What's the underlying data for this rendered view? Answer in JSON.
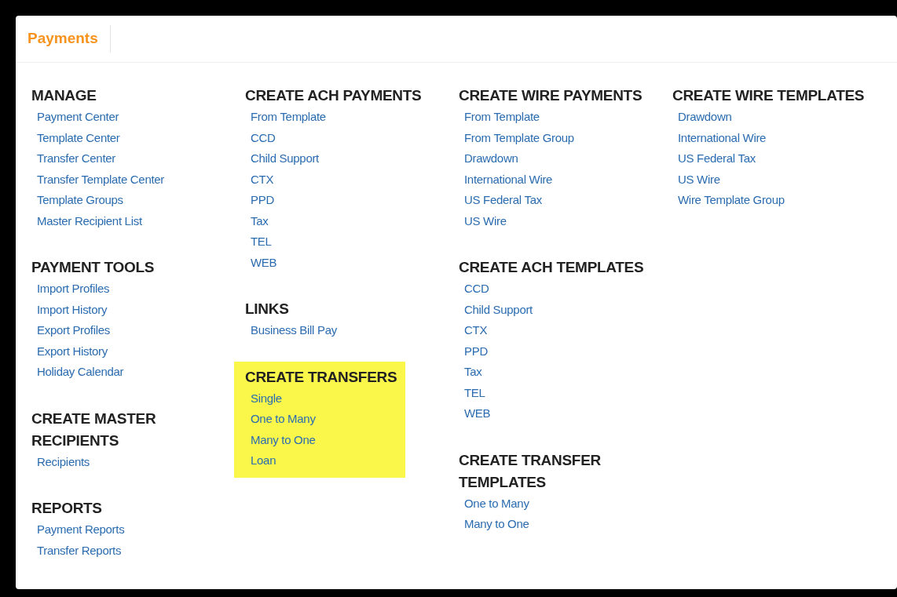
{
  "tabs": [
    {
      "label": "Payments",
      "selected": true
    }
  ],
  "columns": [
    [
      {
        "title": "MANAGE",
        "highlighted": false,
        "links": [
          "Payment Center",
          "Template Center",
          "Transfer Center",
          "Transfer Template Center",
          "Template Groups",
          "Master Recipient List"
        ]
      },
      {
        "title": "PAYMENT TOOLS",
        "highlighted": false,
        "links": [
          "Import Profiles",
          "Import History",
          "Export Profiles",
          "Export History",
          "Holiday Calendar"
        ]
      },
      {
        "title": "CREATE MASTER RECIPIENTS",
        "highlighted": false,
        "links": [
          "Recipients"
        ]
      },
      {
        "title": "REPORTS",
        "highlighted": false,
        "links": [
          "Payment Reports",
          "Transfer Reports"
        ]
      }
    ],
    [
      {
        "title": "CREATE ACH PAYMENTS",
        "highlighted": false,
        "links": [
          "From Template",
          "CCD",
          "Child Support",
          "CTX",
          "PPD",
          "Tax",
          "TEL",
          "WEB"
        ]
      },
      {
        "title": "LINKS",
        "highlighted": false,
        "links": [
          "Business Bill Pay"
        ]
      },
      {
        "title": "CREATE TRANSFERS",
        "highlighted": true,
        "links": [
          "Single",
          "One to Many",
          "Many to One",
          "Loan"
        ]
      }
    ],
    [
      {
        "title": "CREATE WIRE PAYMENTS",
        "highlighted": false,
        "links": [
          "From Template",
          "From Template Group",
          "Drawdown",
          "International Wire",
          "US Federal Tax",
          "US Wire"
        ]
      },
      {
        "title": "CREATE ACH TEMPLATES",
        "highlighted": false,
        "links": [
          "CCD",
          "Child Support",
          "CTX",
          "PPD",
          "Tax",
          "TEL",
          "WEB"
        ]
      },
      {
        "title": "CREATE TRANSFER TEMPLATES",
        "highlighted": false,
        "links": [
          "One to Many",
          "Many to One"
        ]
      }
    ],
    [
      {
        "title": "CREATE WIRE TEMPLATES",
        "highlighted": false,
        "links": [
          "Drawdown",
          "International Wire",
          "US Federal Tax",
          "US Wire",
          "Wire Template Group"
        ]
      }
    ]
  ]
}
